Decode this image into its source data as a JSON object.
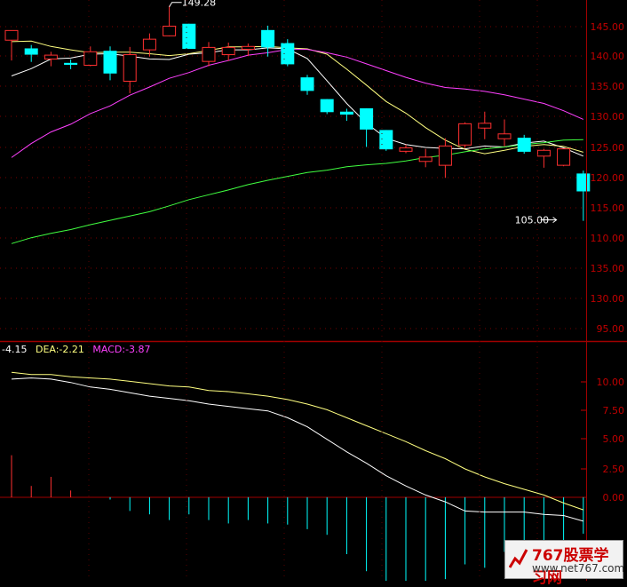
{
  "chart_data": [
    {
      "type": "candlestick",
      "price_axis": {
        "ticks": [
          "145.00",
          "140.00",
          "135.00",
          "130.00",
          "125.00",
          "120.00",
          "115.00",
          "110.00",
          "135.00",
          "130.00",
          "95.00"
        ]
      },
      "annotations": [
        {
          "label": "149.28",
          "value": 149.28,
          "bar_index": 8
        },
        {
          "label": "105.00",
          "value": 105.0,
          "bar_index": 28
        }
      ],
      "colors": {
        "up": "#ff3030",
        "down": "#00ffff",
        "ma_white": "#ffffff",
        "ma_yellow": "#ffff80",
        "ma_magenta": "#ff40ff",
        "ma_green": "#40ff40"
      },
      "candles": [
        {
          "o": 142.2,
          "h": 144.0,
          "l": 138.0,
          "c": 144.2
        },
        {
          "o": 140.5,
          "h": 141.2,
          "l": 137.7,
          "c": 139.2
        },
        {
          "o": 138.3,
          "h": 139.8,
          "l": 136.8,
          "c": 139.1
        },
        {
          "o": 137.5,
          "h": 138.2,
          "l": 136.2,
          "c": 137.1
        },
        {
          "o": 137.0,
          "h": 140.9,
          "l": 136.8,
          "c": 139.8
        },
        {
          "o": 140.0,
          "h": 140.9,
          "l": 133.9,
          "c": 135.3
        },
        {
          "o": 133.7,
          "h": 140.8,
          "l": 131.2,
          "c": 139.2
        },
        {
          "o": 140.2,
          "h": 143.6,
          "l": 138.8,
          "c": 142.4
        },
        {
          "o": 143.1,
          "h": 149.3,
          "l": 143.0,
          "c": 145.1
        },
        {
          "o": 145.6,
          "h": 145.6,
          "l": 140.6,
          "c": 140.4
        },
        {
          "o": 137.8,
          "h": 141.8,
          "l": 136.8,
          "c": 140.7
        },
        {
          "o": 139.2,
          "h": 141.7,
          "l": 137.9,
          "c": 140.7
        },
        {
          "o": 140.3,
          "h": 141.5,
          "l": 138.9,
          "c": 140.9
        },
        {
          "o": 144.3,
          "h": 145.2,
          "l": 138.8,
          "c": 140.7
        },
        {
          "o": 141.6,
          "h": 142.4,
          "l": 136.8,
          "c": 137.2
        },
        {
          "o": 134.5,
          "h": 135.0,
          "l": 130.9,
          "c": 131.7
        },
        {
          "o": 130.0,
          "h": 130.0,
          "l": 126.9,
          "c": 127.3
        },
        {
          "o": 127.4,
          "h": 128.0,
          "l": 125.5,
          "c": 126.8
        },
        {
          "o": 128.1,
          "h": 128.1,
          "l": 120.1,
          "c": 123.7
        },
        {
          "o": 123.6,
          "h": 123.6,
          "l": 119.3,
          "c": 119.6
        },
        {
          "o": 119.2,
          "h": 120.6,
          "l": 118.8,
          "c": 119.9
        },
        {
          "o": 117.1,
          "h": 119.7,
          "l": 115.9,
          "c": 118.0
        },
        {
          "o": 116.3,
          "h": 121.9,
          "l": 113.7,
          "c": 120.3
        },
        {
          "o": 120.5,
          "h": 125.2,
          "l": 119.9,
          "c": 124.9
        },
        {
          "o": 124.0,
          "h": 127.4,
          "l": 121.7,
          "c": 125.0
        },
        {
          "o": 121.8,
          "h": 125.8,
          "l": 120.2,
          "c": 122.8
        },
        {
          "o": 122.0,
          "h": 122.6,
          "l": 118.7,
          "c": 119.1
        },
        {
          "o": 118.2,
          "h": 119.7,
          "l": 115.8,
          "c": 119.4
        },
        {
          "o": 116.3,
          "h": 119.8,
          "l": 116.1,
          "c": 119.7
        },
        {
          "o": 114.6,
          "h": 115.2,
          "l": 104.8,
          "c": 110.9
        }
      ],
      "ma_lines": [
        {
          "color": "white",
          "values": [
            134.8,
            136.3,
            138.3,
            138.5,
            139.3,
            139.4,
            138.9,
            138.3,
            138.2,
            139.3,
            139.6,
            140.2,
            140.2,
            140.6,
            140.4,
            138.4,
            133.8,
            129.1,
            125.0,
            121.9,
            120.6,
            120.0,
            119.8,
            119.7,
            120.3,
            120.1,
            120.9,
            121.3,
            119.9,
            118.2
          ]
        },
        {
          "color": "yellow",
          "values": [
            141.9,
            142.0,
            140.9,
            140.2,
            139.6,
            139.7,
            139.7,
            139.4,
            139.0,
            139.4,
            140.1,
            140.8,
            140.8,
            140.9,
            140.6,
            140.4,
            139.3,
            136.2,
            132.9,
            129.5,
            127.1,
            124.1,
            121.5,
            119.6,
            118.7,
            119.4,
            120.2,
            120.6,
            120.2,
            119.0
          ]
        },
        {
          "color": "magenta",
          "values": [
            117.9,
            120.8,
            123.2,
            124.8,
            127.0,
            128.6,
            130.8,
            132.5,
            134.3,
            135.5,
            137.0,
            138.0,
            139.1,
            139.6,
            140.3,
            140.3,
            139.6,
            138.7,
            137.3,
            135.9,
            134.5,
            133.3,
            132.4,
            132.1,
            131.6,
            130.9,
            130.0,
            129.1,
            127.6,
            125.8
          ]
        },
        {
          "color": "green",
          "values": [
            100.1,
            101.3,
            102.2,
            103.0,
            104.0,
            104.9,
            105.8,
            106.7,
            107.9,
            109.2,
            110.2,
            111.2,
            112.3,
            113.2,
            114.0,
            114.8,
            115.3,
            116.0,
            116.4,
            116.7,
            117.2,
            117.9,
            118.4,
            119.1,
            119.7,
            120.1,
            120.6,
            121.0,
            121.5,
            121.6
          ]
        }
      ]
    },
    {
      "type": "macd",
      "legend": [
        {
          "text": "-4.15",
          "color": "#ffffff"
        },
        {
          "text": "DEA:-2.21",
          "color": "#ffff80"
        },
        {
          "text": "MACD:-3.87",
          "color": "#ff40ff"
        }
      ],
      "y_axis": {
        "ticks": [
          "10.00",
          "7.50",
          "5.00",
          "2.50",
          "0.00"
        ]
      },
      "dif_values": [
        10.4,
        10.5,
        10.4,
        10.1,
        9.7,
        9.5,
        9.2,
        8.9,
        8.7,
        8.5,
        8.2,
        8.0,
        7.8,
        7.6,
        7.0,
        6.2,
        5.1,
        4.0,
        3.0,
        1.9,
        1.0,
        0.2,
        -0.4,
        -1.2,
        -1.3,
        -1.3,
        -1.3,
        -1.5,
        -1.6,
        -2.1
      ],
      "dea_values": [
        11.0,
        10.8,
        10.8,
        10.6,
        10.5,
        10.4,
        10.2,
        10.0,
        9.8,
        9.7,
        9.4,
        9.3,
        9.1,
        8.9,
        8.6,
        8.2,
        7.7,
        7.0,
        6.3,
        5.6,
        4.9,
        4.1,
        3.4,
        2.5,
        1.8,
        1.2,
        0.7,
        0.2,
        -0.5,
        -1.1
      ],
      "histogram": [
        3.7,
        1.0,
        1.8,
        0.6,
        0,
        -0.2,
        -1.2,
        -1.5,
        -2.0,
        -1.5,
        -2.0,
        -2.3,
        -2.0,
        -2.3,
        -2.4,
        -2.8,
        -3.3,
        -5.0,
        -6.5,
        -7.5,
        -8.1,
        -8.2,
        -7.2,
        -5.9,
        -6.2,
        -4.8,
        -5.4,
        -5.3,
        -6.0,
        -3.2
      ]
    }
  ],
  "watermark": {
    "title": "767股票学习网",
    "url": "www.net767.com"
  }
}
